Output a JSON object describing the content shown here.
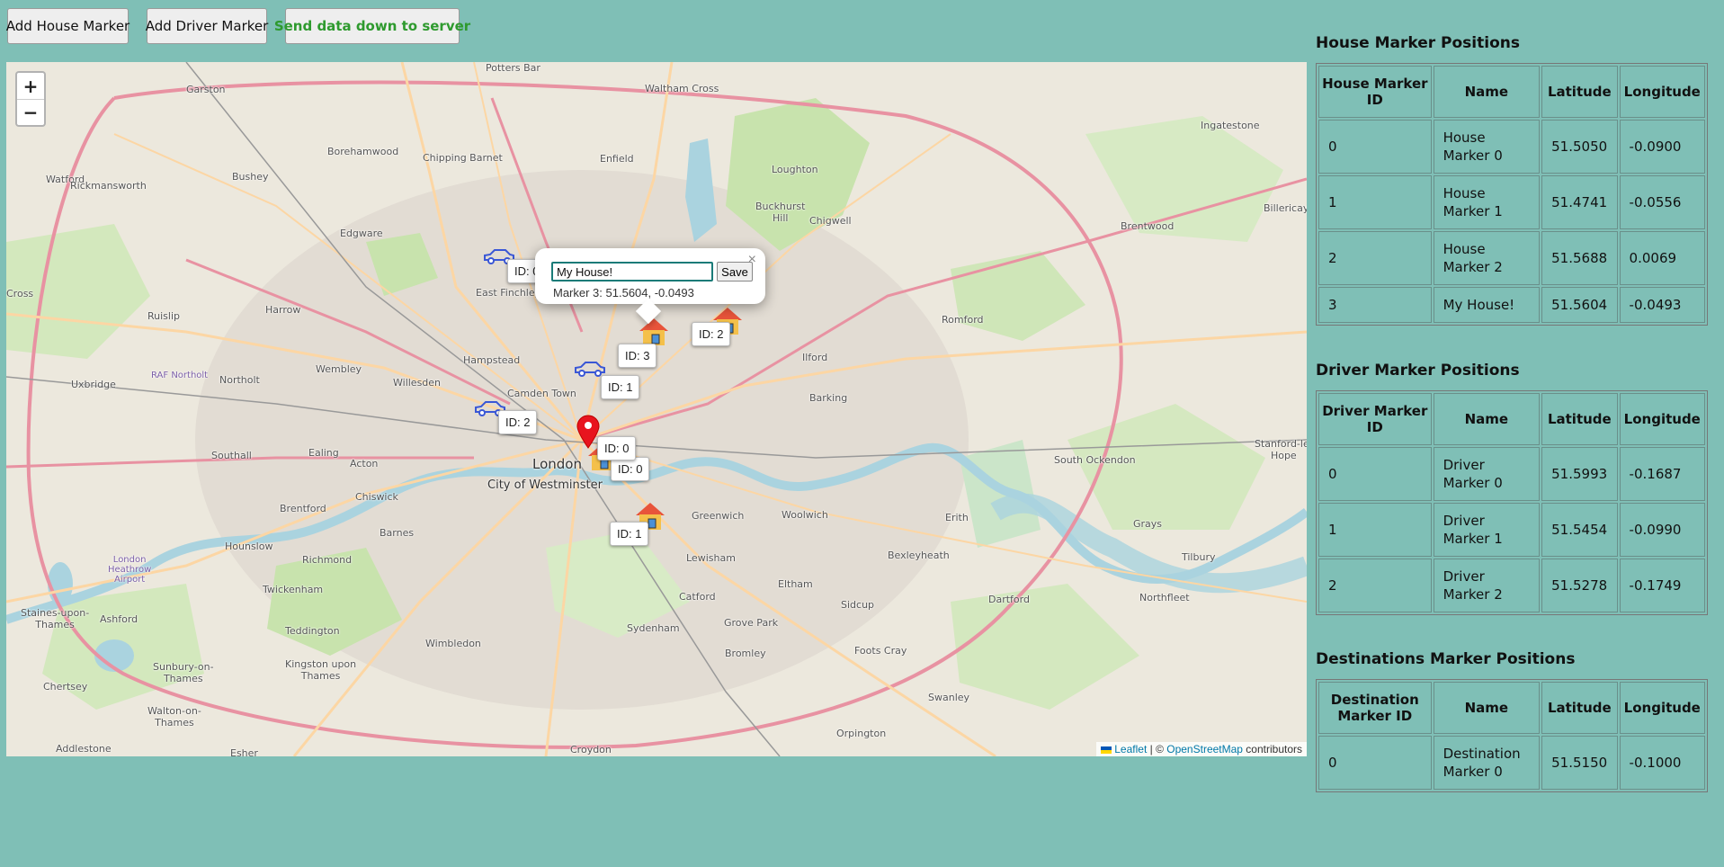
{
  "toolbar": {
    "add_house": "Add House Marker",
    "add_driver": "Add Driver Marker",
    "send": "Send data down to server"
  },
  "map": {
    "zoom_in": "+",
    "zoom_out": "−",
    "attribution_prefix": "Leaflet",
    "attribution_sep": " | © ",
    "attribution_osm": "OpenStreetMap",
    "attribution_suffix": " contributors",
    "popup": {
      "input_value": "My House!",
      "save_label": "Save",
      "close": "×",
      "coords": "Marker 3: 51.5604, -0.0493"
    },
    "tooltips": {
      "car0": "ID: 0",
      "car1": "ID: 1",
      "car2": "ID: 2",
      "house0": "ID: 0",
      "house1": "ID: 1",
      "house2": "ID: 2",
      "house3": "ID: 3",
      "dest0": "ID: 0"
    },
    "labels": {
      "london": "London",
      "westminster": "City of Westminster",
      "camden": "Camden Town",
      "hampstead": "Hampstead",
      "wembley": "Wembley",
      "ilford": "Ilford",
      "barking": "Barking",
      "romford": "Romford",
      "greenwich": "Greenwich",
      "lewisham": "Lewisham",
      "woolwich": "Woolwich",
      "richmond": "Richmond",
      "ealing": "Ealing",
      "acton": "Acton",
      "barnes": "Barnes",
      "watford": "Watford",
      "enfield": "Enfield",
      "loughton": "Loughton",
      "chigwell": "Chigwell",
      "brentwood": "Brentwood",
      "dartford": "Dartford",
      "erith": "Erith",
      "bexleyheath": "Bexleyheath",
      "sidcup": "Sidcup",
      "bromley": "Bromley",
      "croydon": "Croydon",
      "catford": "Catford",
      "sydenham": "Sydenham",
      "eltham": "Eltham",
      "wimbledon": "Wimbledon",
      "hounslow": "Hounslow",
      "twickenham": "Twickenham",
      "teddington": "Teddington",
      "harrow": "Harrow",
      "edgware": "Edgware",
      "uxbridge": "Uxbridge",
      "ruislip": "Ruislip",
      "southall": "Southall",
      "brentford": "Brentford",
      "chiswick": "Chiswick",
      "northolt": "Northolt",
      "willesden": "Willesden",
      "eastfinchley": "East Finchley",
      "chippingbarnet": "Chipping Barnet",
      "borehamwood": "Borehamwood",
      "bushey": "Bushey",
      "rickmansworth": "Rickmansworth",
      "garston": "Garston",
      "pottersbar": "Potters Bar",
      "walthamcross": "Waltham Cross",
      "buckhursthill": "Buckhurst\nHill",
      "ingatestone": "Ingatestone",
      "billericay": "Billericay",
      "grays": "Grays",
      "tilbury": "Tilbury",
      "northfleet": "Northfleet",
      "southockendon": "South Ockendon",
      "stanford": "Stanford-le-\nHope",
      "swanley": "Swanley",
      "orpington": "Orpington",
      "footscray": "Foots Cray",
      "groveark": "Grove Park",
      "staines": "Staines-upon-\nThames",
      "ashford": "Ashford",
      "sunbury": "Sunbury-on-\nThames",
      "walton": "Walton-on-\nThames",
      "chertsey": "Chertsey",
      "addlestone": "Addlestone",
      "esher": "Esher",
      "kingston": "Kingston upon\nThames",
      "heathrow": "London\nHeathrow\nAirport",
      "rafnortholt": "RAF Northolt",
      "cross": "Cross"
    }
  },
  "house_table": {
    "title": "House Marker Positions",
    "headers": [
      "House Marker ID",
      "Name",
      "Latitude",
      "Longitude"
    ],
    "rows": [
      [
        "0",
        "House Marker 0",
        "51.5050",
        "-0.0900"
      ],
      [
        "1",
        "House Marker 1",
        "51.4741",
        "-0.0556"
      ],
      [
        "2",
        "House Marker 2",
        "51.5688",
        "0.0069"
      ],
      [
        "3",
        "My House!",
        "51.5604",
        "-0.0493"
      ]
    ]
  },
  "driver_table": {
    "title": "Driver Marker Positions",
    "headers": [
      "Driver Marker ID",
      "Name",
      "Latitude",
      "Longitude"
    ],
    "rows": [
      [
        "0",
        "Driver Marker 0",
        "51.5993",
        "-0.1687"
      ],
      [
        "1",
        "Driver Marker 1",
        "51.5454",
        "-0.0990"
      ],
      [
        "2",
        "Driver Marker 2",
        "51.5278",
        "-0.1749"
      ]
    ]
  },
  "dest_table": {
    "title": "Destinations Marker Positions",
    "headers": [
      "Destination Marker ID",
      "Name",
      "Latitude",
      "Longitude"
    ],
    "rows": [
      [
        "0",
        "Destination Marker 0",
        "51.5150",
        "-0.1000"
      ]
    ]
  },
  "colors": {
    "background": "#7fbfb6",
    "send_text": "#2e9a2e",
    "river": "#aad3df",
    "park": "#c8e6b0",
    "motorway": "#e892a2",
    "primary_road": "#fcd6a4",
    "dest_marker": "#e8141e"
  }
}
